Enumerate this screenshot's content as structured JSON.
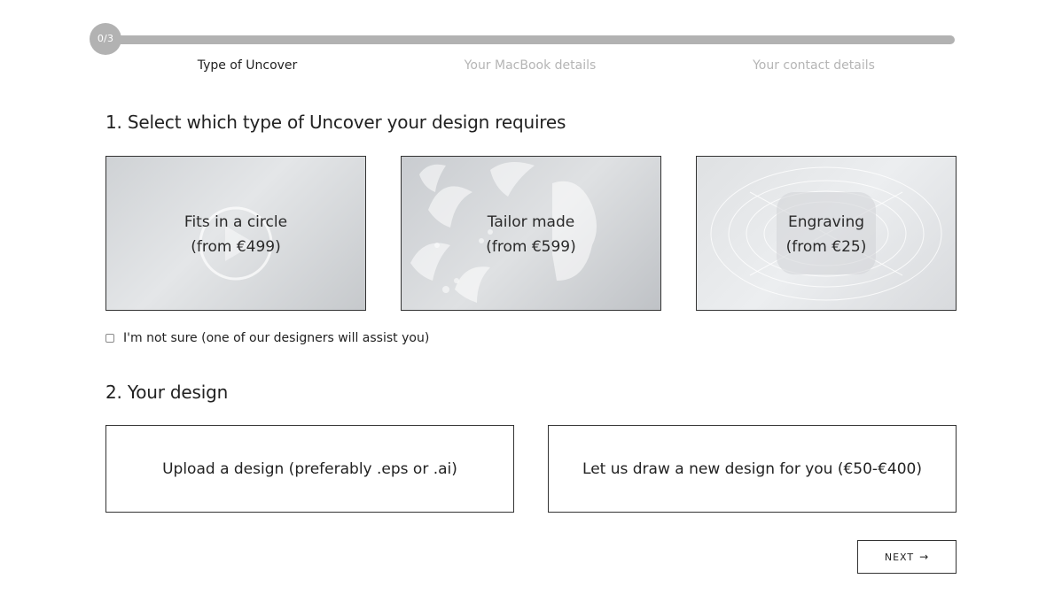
{
  "progress": {
    "badge": "0/3",
    "fraction": 0,
    "steps": [
      {
        "label": "Type of Uncover",
        "active": true
      },
      {
        "label": "Your MacBook details",
        "active": false
      },
      {
        "label": "Your contact details",
        "active": false
      }
    ]
  },
  "section1": {
    "title": "1. Select which type of Uncover your design requires",
    "cards": [
      {
        "name": "Fits in a circle",
        "price": "(from €499)"
      },
      {
        "name": "Tailor made",
        "price": "(from €599)"
      },
      {
        "name": "Engraving",
        "price": "(from €25)"
      }
    ],
    "not_sure_label": "I'm not sure (one of our designers will assist you)"
  },
  "section2": {
    "title": "2. Your design",
    "upload_label": "Upload a design (preferably .eps or .ai)",
    "draw_label": "Let us draw a new design for you (€50-€400)"
  },
  "next": {
    "label": "NEXT",
    "arrow": "→"
  },
  "colors": {
    "track": "#b2b2b2",
    "inactive_text": "#b5b5b5",
    "border": "#333333"
  }
}
